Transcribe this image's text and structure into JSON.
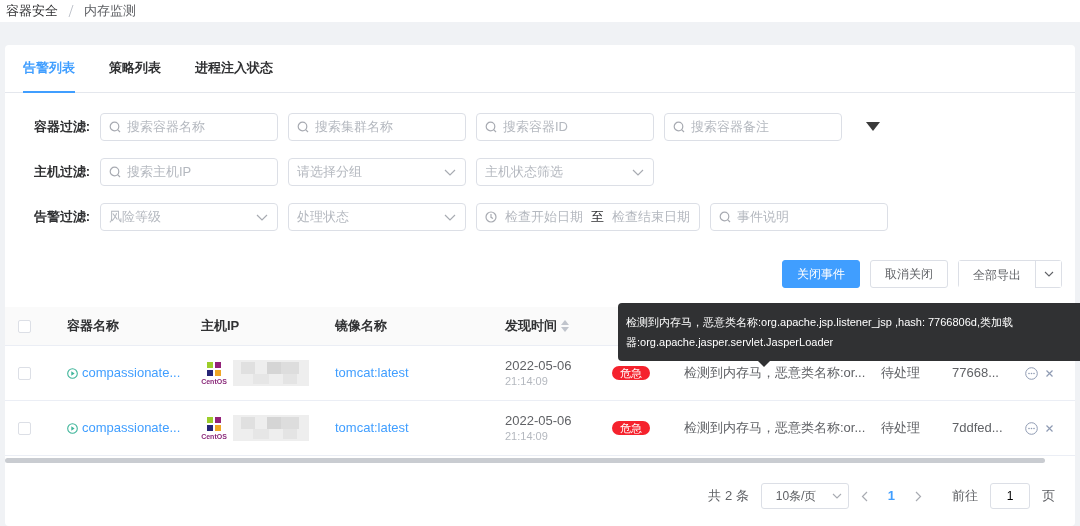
{
  "breadcrumb": [
    "容器安全",
    "内存监测"
  ],
  "tabs": [
    {
      "label": "告警列表",
      "selected": true
    },
    {
      "label": "策略列表",
      "selected": false
    },
    {
      "label": "进程注入状态",
      "selected": false
    }
  ],
  "filters": [
    {
      "label": "容器过滤:",
      "fields": [
        {
          "kind": "search",
          "placeholder": "搜索容器名称"
        },
        {
          "kind": "search",
          "placeholder": "搜索集群名称"
        },
        {
          "kind": "search",
          "placeholder": "搜索容器ID"
        },
        {
          "kind": "search",
          "placeholder": "搜索容器备注"
        }
      ],
      "expand_toggle": true
    },
    {
      "label": "主机过滤:",
      "fields": [
        {
          "kind": "search",
          "placeholder": "搜索主机IP"
        },
        {
          "kind": "select",
          "placeholder": "请选择分组"
        },
        {
          "kind": "select",
          "placeholder": "主机状态筛选"
        }
      ],
      "expand_toggle": false
    },
    {
      "label": "告警过滤:",
      "fields": [
        {
          "kind": "select",
          "placeholder": "风险等级"
        },
        {
          "kind": "select",
          "placeholder": "处理状态"
        },
        {
          "kind": "daterange",
          "start_placeholder": "检查开始日期",
          "separator": "至",
          "end_placeholder": "检查结束日期"
        },
        {
          "kind": "search",
          "placeholder": "事件说明"
        }
      ],
      "expand_toggle": false
    }
  ],
  "buttons": [
    {
      "label": "关闭事件",
      "kind": "primary"
    },
    {
      "label": "取消关闭",
      "kind": "default"
    },
    {
      "label": "全部导出",
      "kind": "split"
    }
  ],
  "table": {
    "all_selected": false,
    "columns": [
      {
        "label": "容器名称",
        "sortable": false
      },
      {
        "label": "主机IP",
        "sortable": false
      },
      {
        "label": "镜像名称",
        "sortable": false
      },
      {
        "label": "发现时间",
        "sortable": true
      }
    ],
    "rows": [
      {
        "selected": false,
        "container": "compassionate...",
        "os_label": "CentOS",
        "image": "tomcat:latest",
        "date": "2022-05-06",
        "time": "21:14:09",
        "risk": "危急",
        "description": "检测到内存马，恶意类名称:or...",
        "status": "待处理",
        "hash": "77668..."
      },
      {
        "selected": false,
        "container": "compassionate...",
        "os_label": "CentOS",
        "image": "tomcat:latest",
        "date": "2022-05-06",
        "time": "21:14:09",
        "risk": "危急",
        "description": "检测到内存马，恶意类名称:or...",
        "status": "待处理",
        "hash": "7ddfed..."
      }
    ]
  },
  "tooltip": "检测到内存马，恶意类名称:org.apache.jsp.listener_jsp ,hash: 7766806d,类加载器:org.apache.jasper.servlet.JasperLoader",
  "pagination": {
    "total": "共 2 条",
    "page_size": "10条/页",
    "pages": [
      {
        "label": "1",
        "selected": true
      }
    ],
    "goto_label": "前往",
    "goto_value": "1",
    "page_suffix": "页"
  }
}
